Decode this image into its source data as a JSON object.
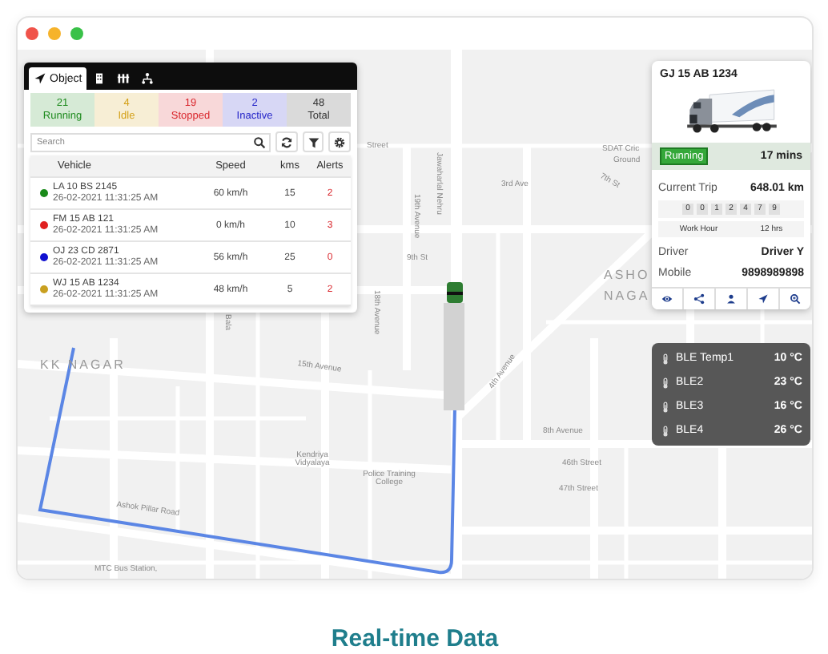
{
  "tracker": {
    "tabs": [
      {
        "kind": "object",
        "label": "Object",
        "selected": true
      },
      {
        "kind": "building",
        "selected": false
      },
      {
        "kind": "grid",
        "selected": false
      },
      {
        "kind": "network",
        "selected": false
      }
    ],
    "status_counts": [
      {
        "count": "21",
        "label": "Running",
        "color": "#1e8a1e"
      },
      {
        "count": "4",
        "label": "Idle",
        "color": "#d4a017"
      },
      {
        "count": "19",
        "label": "Stopped",
        "color": "#d9262c"
      },
      {
        "count": "2",
        "label": "Inactive",
        "color": "#2424c8"
      },
      {
        "count": "48",
        "label": "Total",
        "color": "#333333"
      }
    ],
    "search": {
      "placeholder": "Search"
    },
    "tools": [
      {
        "kind": "refresh"
      },
      {
        "kind": "filter"
      },
      {
        "kind": "settings"
      }
    ],
    "table": {
      "columns": [
        "Vehicle",
        "Speed",
        "kms",
        "Alerts"
      ],
      "rows": [
        {
          "color": "#1a8a1a",
          "vehicle": "LA 10 BS 2145",
          "time": "26-02-2021 11:31:25 AM",
          "speed": "60 km/h",
          "kms": "15",
          "alerts": "2"
        },
        {
          "color": "#e02020",
          "vehicle": "FM 15 AB 121",
          "time": "26-02-2021 11:31:25 AM",
          "speed": "0 km/h",
          "kms": "10",
          "alerts": "3"
        },
        {
          "color": "#1010d0",
          "vehicle": "OJ 23 CD 2871",
          "time": "26-02-2021 11:31:25 AM",
          "speed": "56 km/h",
          "kms": "25",
          "alerts": "0"
        },
        {
          "color": "#c9a020",
          "vehicle": "WJ 15 AB 1234",
          "time": "26-02-2021 11:31:25 AM",
          "speed": "48 km/h",
          "kms": "5",
          "alerts": "2"
        }
      ]
    }
  },
  "vehicle_card": {
    "plate": "GJ 15 AB 1234",
    "status": "Running",
    "duration": "17 mins",
    "trip_label": "Current Trip",
    "trip_value": "648.01 km",
    "odometer": [
      "0",
      "0",
      "1",
      "2",
      "4",
      "7",
      "9"
    ],
    "work_hour_label": "Work Hour",
    "work_hour_value": "12 hrs",
    "details": [
      {
        "label": "Driver",
        "value": "Driver Y"
      },
      {
        "label": "Mobile",
        "value": "9898989898"
      }
    ],
    "actions": [
      {
        "kind": "eye"
      },
      {
        "kind": "share"
      },
      {
        "kind": "person"
      },
      {
        "kind": "navigate"
      },
      {
        "kind": "zoom"
      }
    ]
  },
  "sensors": [
    {
      "name": "BLE Temp1",
      "value": "10 °C"
    },
    {
      "name": "BLE2",
      "value": "23 °C"
    },
    {
      "name": "BLE3",
      "value": "16 °C"
    },
    {
      "name": "BLE4",
      "value": "26 °C"
    }
  ],
  "map": {
    "labels": [
      "Street",
      "Bala",
      "KK NAGAR",
      "15th Avenue",
      "19th Avenue",
      "Jawaharlal Nehru",
      "9th St",
      "18th Avenue",
      "3rd Ave",
      "7th St",
      "SDAT Cric",
      "Ground",
      "ASHO",
      "NAGA",
      "4th Avenue",
      "8th Avenue",
      "46th Street",
      "47th Street",
      "Kendriya Vidyalaya",
      "Police Training College",
      "Ashok Pillar Road",
      "MTC Bus Station,"
    ]
  },
  "caption": "Real-time Data"
}
